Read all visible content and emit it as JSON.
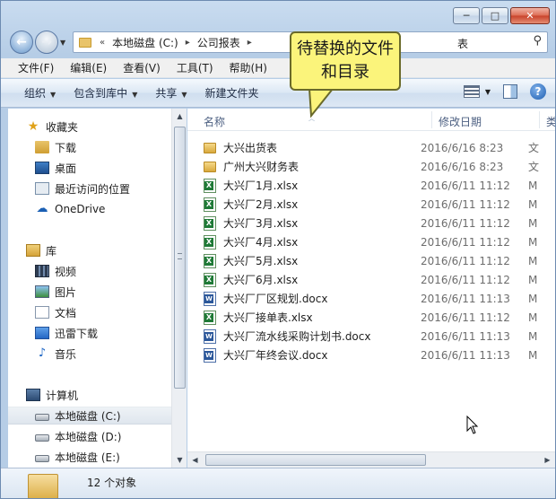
{
  "window": {
    "controls": {
      "minimize": "─",
      "maximize": "□",
      "close": "✕"
    }
  },
  "nav": {
    "back": "←",
    "forward": "→",
    "dropdown": "▼",
    "address": {
      "prefix": "«",
      "segments": [
        "本地磁盘 (C:)",
        "公司报表"
      ],
      "separator": "▸",
      "tail": "表",
      "search_icon": "⚲"
    }
  },
  "menubar": [
    "文件(F)",
    "编辑(E)",
    "查看(V)",
    "工具(T)",
    "帮助(H)"
  ],
  "commands": {
    "organize": "组织",
    "include_library": "包含到库中",
    "share": "共享",
    "new_folder": "新建文件夹",
    "help": "?"
  },
  "navpane": {
    "favorites": "收藏夹",
    "downloads": "下载",
    "desktop": "桌面",
    "recent": "最近访问的位置",
    "onedrive": "OneDrive",
    "libraries": "库",
    "videos": "视频",
    "pictures": "图片",
    "documents": "文档",
    "xunlei": "迅雷下载",
    "music": "音乐",
    "computer": "计算机",
    "drive_c": "本地磁盘 (C:)",
    "drive_d": "本地磁盘 (D:)",
    "drive_e": "本地磁盘 (E:)"
  },
  "columns": {
    "name": "名称",
    "date": "修改日期",
    "type": "类"
  },
  "files": [
    {
      "name": "大兴出货表",
      "date": "2016/6/16 8:23",
      "type": "文",
      "kind": "folder"
    },
    {
      "name": "广州大兴财务表",
      "date": "2016/6/16 8:23",
      "type": "文",
      "kind": "folder"
    },
    {
      "name": "大兴厂1月.xlsx",
      "date": "2016/6/11 11:12",
      "type": "M",
      "kind": "xlsx"
    },
    {
      "name": "大兴厂2月.xlsx",
      "date": "2016/6/11 11:12",
      "type": "M",
      "kind": "xlsx"
    },
    {
      "name": "大兴厂3月.xlsx",
      "date": "2016/6/11 11:12",
      "type": "M",
      "kind": "xlsx"
    },
    {
      "name": "大兴厂4月.xlsx",
      "date": "2016/6/11 11:12",
      "type": "M",
      "kind": "xlsx"
    },
    {
      "name": "大兴厂5月.xlsx",
      "date": "2016/6/11 11:12",
      "type": "M",
      "kind": "xlsx"
    },
    {
      "name": "大兴厂6月.xlsx",
      "date": "2016/6/11 11:12",
      "type": "M",
      "kind": "xlsx"
    },
    {
      "name": "大兴厂厂区规划.docx",
      "date": "2016/6/11 11:13",
      "type": "M",
      "kind": "docx"
    },
    {
      "name": "大兴厂接单表.xlsx",
      "date": "2016/6/11 11:12",
      "type": "M",
      "kind": "xlsx"
    },
    {
      "name": "大兴厂流水线采购计划书.docx",
      "date": "2016/6/11 11:13",
      "type": "M",
      "kind": "docx"
    },
    {
      "name": "大兴厂年终会议.docx",
      "date": "2016/6/11 11:13",
      "type": "M",
      "kind": "docx"
    }
  ],
  "status": {
    "count": "12 个对象"
  },
  "callout": {
    "text": "待替换的文件和目录"
  },
  "colors": {
    "callout_fill": "#fbf47b",
    "selection": "#dfe6ee",
    "command_text": "#1e2b43"
  }
}
